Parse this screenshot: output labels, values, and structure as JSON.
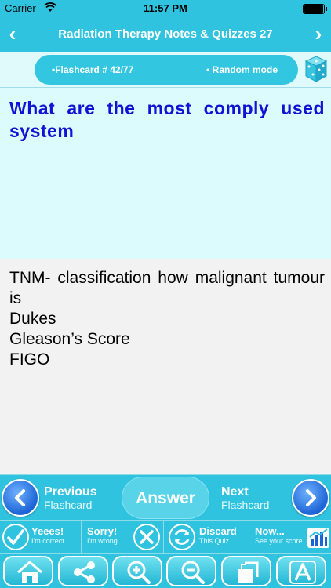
{
  "status_bar": {
    "carrier": "Carrier",
    "time": "11:57 PM"
  },
  "nav": {
    "title": "Radiation Therapy Notes & Quizzes 27",
    "back_icon": "chevron-left-icon",
    "forward_icon": "chevron-right-icon"
  },
  "info": {
    "card_number": "•Flashcard #  42/77",
    "mode": "• Random mode",
    "dice_icon": "dice-icon"
  },
  "question": {
    "text": "What are the most comply used system"
  },
  "answer": {
    "lines": [
      "TNM- classification how malignant tumour is",
      "Dukes",
      "Gleason’s Score",
      "FIGO"
    ]
  },
  "controls": {
    "previous": {
      "title": "Previous",
      "subtitle": "Flashcard"
    },
    "answer_label": "Answer",
    "next": {
      "title": "Next",
      "subtitle": "Flashcard"
    }
  },
  "score": {
    "correct": {
      "title": "Yeees!",
      "subtitle": "I'm correct"
    },
    "wrong": {
      "title": "Sorry!",
      "subtitle": "I'm wrong"
    },
    "discard": {
      "title": "Discard",
      "subtitle": "This Quiz"
    },
    "now": {
      "title": "Now...",
      "subtitle": "See your score"
    }
  },
  "tools": [
    {
      "icon": "home-icon"
    },
    {
      "icon": "share-icon"
    },
    {
      "icon": "zoom-in-icon"
    },
    {
      "icon": "zoom-out-icon"
    },
    {
      "icon": "bookmark-icon"
    },
    {
      "icon": "font-icon"
    }
  ],
  "colors": {
    "bar": "#2fc3df",
    "question_bg": "#dcfbfc",
    "question_text": "#1212d6",
    "arrow_blue": "#1c64d6"
  }
}
